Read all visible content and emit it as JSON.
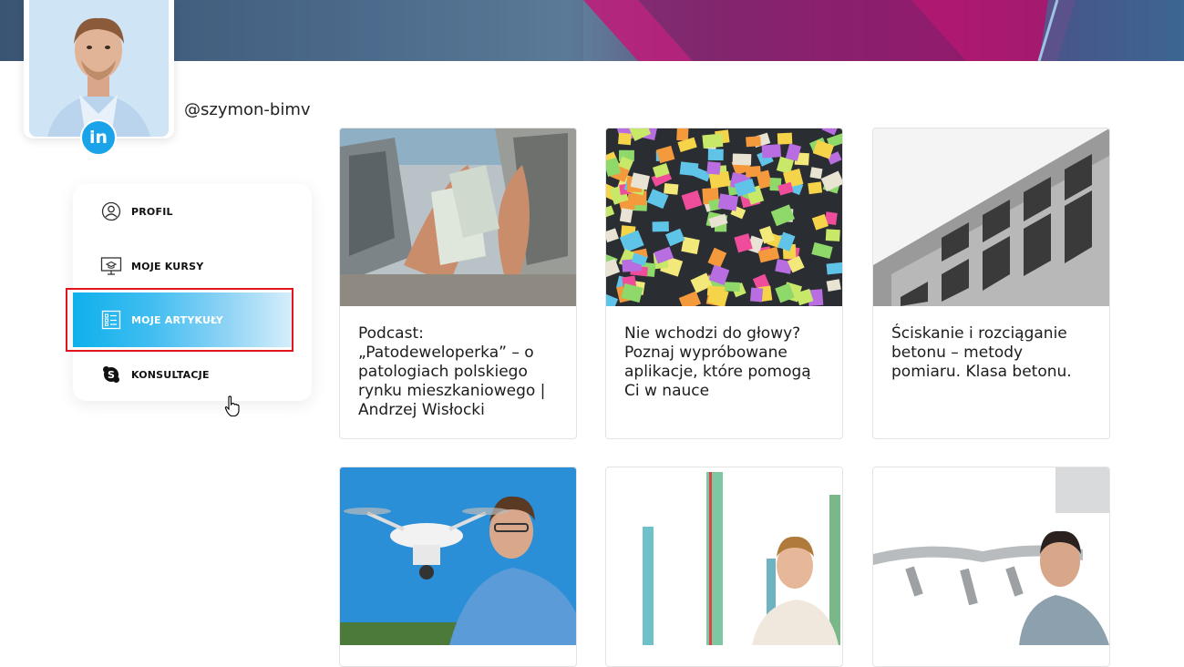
{
  "profile": {
    "username": "@szymon-bimv",
    "linkedin_label": "in"
  },
  "menu": {
    "items": [
      {
        "label": "PROFIL",
        "icon": "user-circle-icon",
        "active": false
      },
      {
        "label": "MOJE KURSY",
        "icon": "monitor-graduation-icon",
        "active": false
      },
      {
        "label": "MOJE ARTYKUŁY",
        "icon": "article-list-icon",
        "active": true
      },
      {
        "label": "KONSULTACJE",
        "icon": "skype-icon",
        "active": false
      }
    ]
  },
  "articles": [
    {
      "title": "Podcast: „Patodeweloperka” – o patologiach polskiego rynku mieszkaniowego | Andrzej Wisłocki",
      "thumb": "collapsed-building-photo"
    },
    {
      "title": "Nie wchodzi do głowy? Poznaj wypróbowane aplikacje, które pomogą Ci w nauce",
      "thumb": "sticky-notes-photo"
    },
    {
      "title": "Ściskanie i rozciąganie betonu – metody pomiaru. Klasa betonu.",
      "thumb": "concrete-facade-photo"
    },
    {
      "title": "",
      "thumb": "drone-man-photo"
    },
    {
      "title": "",
      "thumb": "rebar-columns-man-photo"
    },
    {
      "title": "",
      "thumb": "pipes-model-man-photo"
    }
  ],
  "colors": {
    "accent": "#0fb0ec",
    "linkedin": "#1aa3e8",
    "highlight": "#e0161c"
  }
}
